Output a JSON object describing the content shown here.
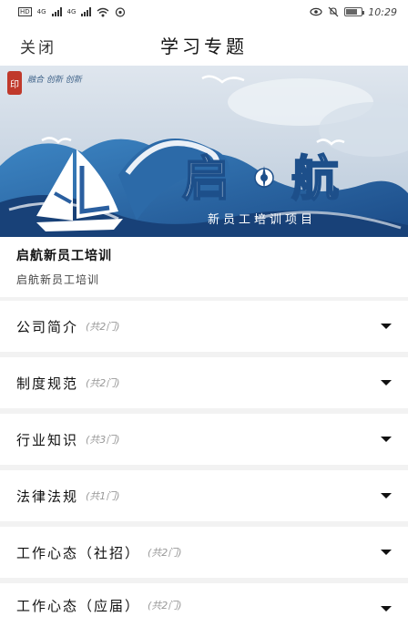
{
  "status_bar": {
    "sim1": "HD",
    "sim2": "HD",
    "network1": "4G",
    "network2": "4G",
    "time": "10:29",
    "battery_level": 0.75,
    "icons": [
      "signal-icon",
      "wifi-icon",
      "eye-icon",
      "mute-icon",
      "battery-icon"
    ]
  },
  "header": {
    "close_label": "关闭",
    "title": "学习专题"
  },
  "banner": {
    "brand_text": "融合 创新 创新",
    "headline_left": "启",
    "headline_right": "航",
    "subtitle": "新员工培训项目",
    "colors": {
      "sea": "#2f73b0",
      "deep": "#1d4f8a",
      "foam": "#ffffff",
      "sky": "#c9d6e3",
      "seal": "#c0392b"
    }
  },
  "course": {
    "title": "启航新员工培训",
    "subtitle": "启航新员工培训"
  },
  "categories": [
    {
      "name": "公司简介",
      "count": "(共2门)"
    },
    {
      "name": "制度规范",
      "count": "(共2门)"
    },
    {
      "name": "行业知识",
      "count": "(共3门)"
    },
    {
      "name": "法律法规",
      "count": "(共1门)"
    },
    {
      "name": "工作心态（社招）",
      "count": "(共2门)"
    },
    {
      "name": "工作心态（应届）",
      "count": "(共2门)"
    }
  ]
}
